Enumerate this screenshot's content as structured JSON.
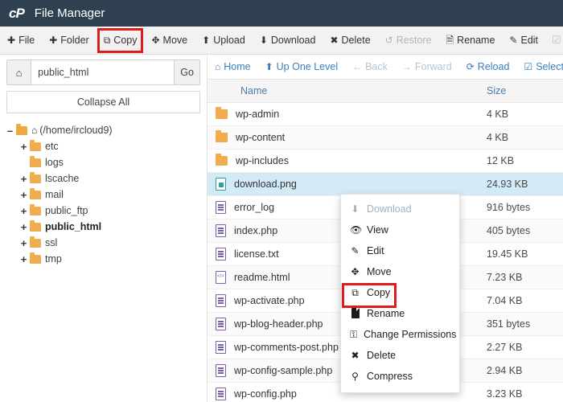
{
  "header": {
    "logo": "cP",
    "title": "File Manager"
  },
  "toolbar": {
    "items": [
      {
        "icon": "plus-icon",
        "glyph": "✚",
        "label": "File",
        "disabled": false,
        "highlighted": false
      },
      {
        "icon": "plus-icon",
        "glyph": "✚",
        "label": "Folder",
        "disabled": false,
        "highlighted": false
      },
      {
        "icon": "copy-icon",
        "glyph": "⧉",
        "label": "Copy",
        "disabled": false,
        "highlighted": true
      },
      {
        "icon": "move-icon",
        "glyph": "✥",
        "label": "Move",
        "disabled": false,
        "highlighted": false
      },
      {
        "icon": "upload-icon",
        "glyph": "⬆",
        "label": "Upload",
        "disabled": false,
        "highlighted": false
      },
      {
        "icon": "download-icon",
        "glyph": "⬇",
        "label": "Download",
        "disabled": false,
        "highlighted": false
      },
      {
        "icon": "delete-x-icon",
        "glyph": "✖",
        "label": "Delete",
        "disabled": false,
        "highlighted": false
      },
      {
        "icon": "restore-icon",
        "glyph": "↺",
        "label": "Restore",
        "disabled": true,
        "highlighted": false
      },
      {
        "icon": "rename-doc-icon",
        "glyph": "🗎",
        "label": "Rename",
        "disabled": false,
        "highlighted": false
      },
      {
        "icon": "pencil-icon",
        "glyph": "✎",
        "label": "Edit",
        "disabled": false,
        "highlighted": false
      }
    ],
    "trailing_icon": {
      "icon": "edit-box-icon",
      "glyph": "☑",
      "disabled": true
    },
    "highlight_color": "#e01b1b"
  },
  "sidebar": {
    "path_home_icon": "home-icon",
    "path_value": "public_html",
    "path_placeholder": "public_html",
    "go_label": "Go",
    "collapse_label": "Collapse All",
    "tree": [
      {
        "expander": "–",
        "label": "(/home/ircloud9)",
        "indent": 0,
        "bold": false,
        "home": true,
        "open": true
      },
      {
        "expander": "+",
        "label": "etc",
        "indent": 1,
        "bold": false,
        "home": false,
        "open": false
      },
      {
        "expander": "",
        "label": "logs",
        "indent": 1,
        "bold": false,
        "home": false,
        "open": false
      },
      {
        "expander": "+",
        "label": "lscache",
        "indent": 1,
        "bold": false,
        "home": false,
        "open": false
      },
      {
        "expander": "+",
        "label": "mail",
        "indent": 1,
        "bold": false,
        "home": false,
        "open": false
      },
      {
        "expander": "+",
        "label": "public_ftp",
        "indent": 1,
        "bold": false,
        "home": false,
        "open": false
      },
      {
        "expander": "+",
        "label": "public_html",
        "indent": 1,
        "bold": true,
        "home": false,
        "open": false
      },
      {
        "expander": "+",
        "label": "ssl",
        "indent": 1,
        "bold": false,
        "home": false,
        "open": false
      },
      {
        "expander": "+",
        "label": "tmp",
        "indent": 1,
        "bold": false,
        "home": false,
        "open": false
      }
    ]
  },
  "navbar": {
    "items": [
      {
        "icon": "home-icon",
        "glyph": "⌂",
        "label": "Home",
        "disabled": false
      },
      {
        "icon": "up-one-level-icon",
        "glyph": "⬆",
        "label": "Up One Level",
        "disabled": false
      },
      {
        "icon": "arrow-left-icon",
        "glyph": "←",
        "label": "Back",
        "disabled": true
      },
      {
        "icon": "arrow-right-icon",
        "glyph": "→",
        "label": "Forward",
        "disabled": true
      },
      {
        "icon": "reload-icon",
        "glyph": "⟳",
        "label": "Reload",
        "disabled": false
      },
      {
        "icon": "checkbox-icon",
        "glyph": "☑",
        "label": "Select A",
        "disabled": false
      }
    ]
  },
  "file_list": {
    "columns": {
      "name": "Name",
      "size": "Size"
    },
    "rows": [
      {
        "icon": "folder-icon",
        "type": "folder",
        "name": "wp-admin",
        "size": "4 KB",
        "selected": false
      },
      {
        "icon": "folder-icon",
        "type": "folder",
        "name": "wp-content",
        "size": "4 KB",
        "selected": false
      },
      {
        "icon": "folder-icon",
        "type": "folder",
        "name": "wp-includes",
        "size": "12 KB",
        "selected": false
      },
      {
        "icon": "image-file-icon",
        "type": "image",
        "name": "download.png",
        "size": "24.93 KB",
        "selected": true
      },
      {
        "icon": "document-file-icon",
        "type": "doc",
        "name": "error_log",
        "size": "916 bytes",
        "selected": false
      },
      {
        "icon": "document-file-icon",
        "type": "doc",
        "name": "index.php",
        "size": "405 bytes",
        "selected": false
      },
      {
        "icon": "document-file-icon",
        "type": "doc",
        "name": "license.txt",
        "size": "19.45 KB",
        "selected": false
      },
      {
        "icon": "html-file-icon",
        "type": "code",
        "name": "readme.html",
        "size": "7.23 KB",
        "selected": false
      },
      {
        "icon": "document-file-icon",
        "type": "doc",
        "name": "wp-activate.php",
        "size": "7.04 KB",
        "selected": false
      },
      {
        "icon": "document-file-icon",
        "type": "doc",
        "name": "wp-blog-header.php",
        "size": "351 bytes",
        "selected": false
      },
      {
        "icon": "document-file-icon",
        "type": "doc",
        "name": "wp-comments-post.php",
        "size": "2.27 KB",
        "selected": false
      },
      {
        "icon": "document-file-icon",
        "type": "doc",
        "name": "wp-config-sample.php",
        "size": "2.94 KB",
        "selected": false
      },
      {
        "icon": "document-file-icon",
        "type": "doc",
        "name": "wp-config.php",
        "size": "3.23 KB",
        "selected": false
      }
    ]
  },
  "context_menu": {
    "items": [
      {
        "icon": "download-icon",
        "glyph": "⬇",
        "label": "Download",
        "disabled": true,
        "highlighted": false
      },
      {
        "icon": "eye-icon",
        "glyph": "👁",
        "label": "View",
        "disabled": false,
        "highlighted": false
      },
      {
        "icon": "pencil-icon",
        "glyph": "✎",
        "label": "Edit",
        "disabled": false,
        "highlighted": false
      },
      {
        "icon": "move-icon",
        "glyph": "✥",
        "label": "Move",
        "disabled": false,
        "highlighted": false
      },
      {
        "icon": "copy-icon",
        "glyph": "⧉",
        "label": "Copy",
        "disabled": false,
        "highlighted": true
      },
      {
        "icon": "rename-doc-icon",
        "glyph": "",
        "label": "Rename",
        "disabled": false,
        "highlighted": false
      },
      {
        "icon": "key-icon",
        "glyph": "⚿",
        "label": "Change Permissions",
        "disabled": false,
        "highlighted": false
      },
      {
        "icon": "delete-x-icon",
        "glyph": "✖",
        "label": "Delete",
        "disabled": false,
        "highlighted": false
      },
      {
        "icon": "compress-icon",
        "glyph": "⚲",
        "label": "Compress",
        "disabled": false,
        "highlighted": false
      }
    ],
    "highlight_color": "#e01b1b"
  }
}
